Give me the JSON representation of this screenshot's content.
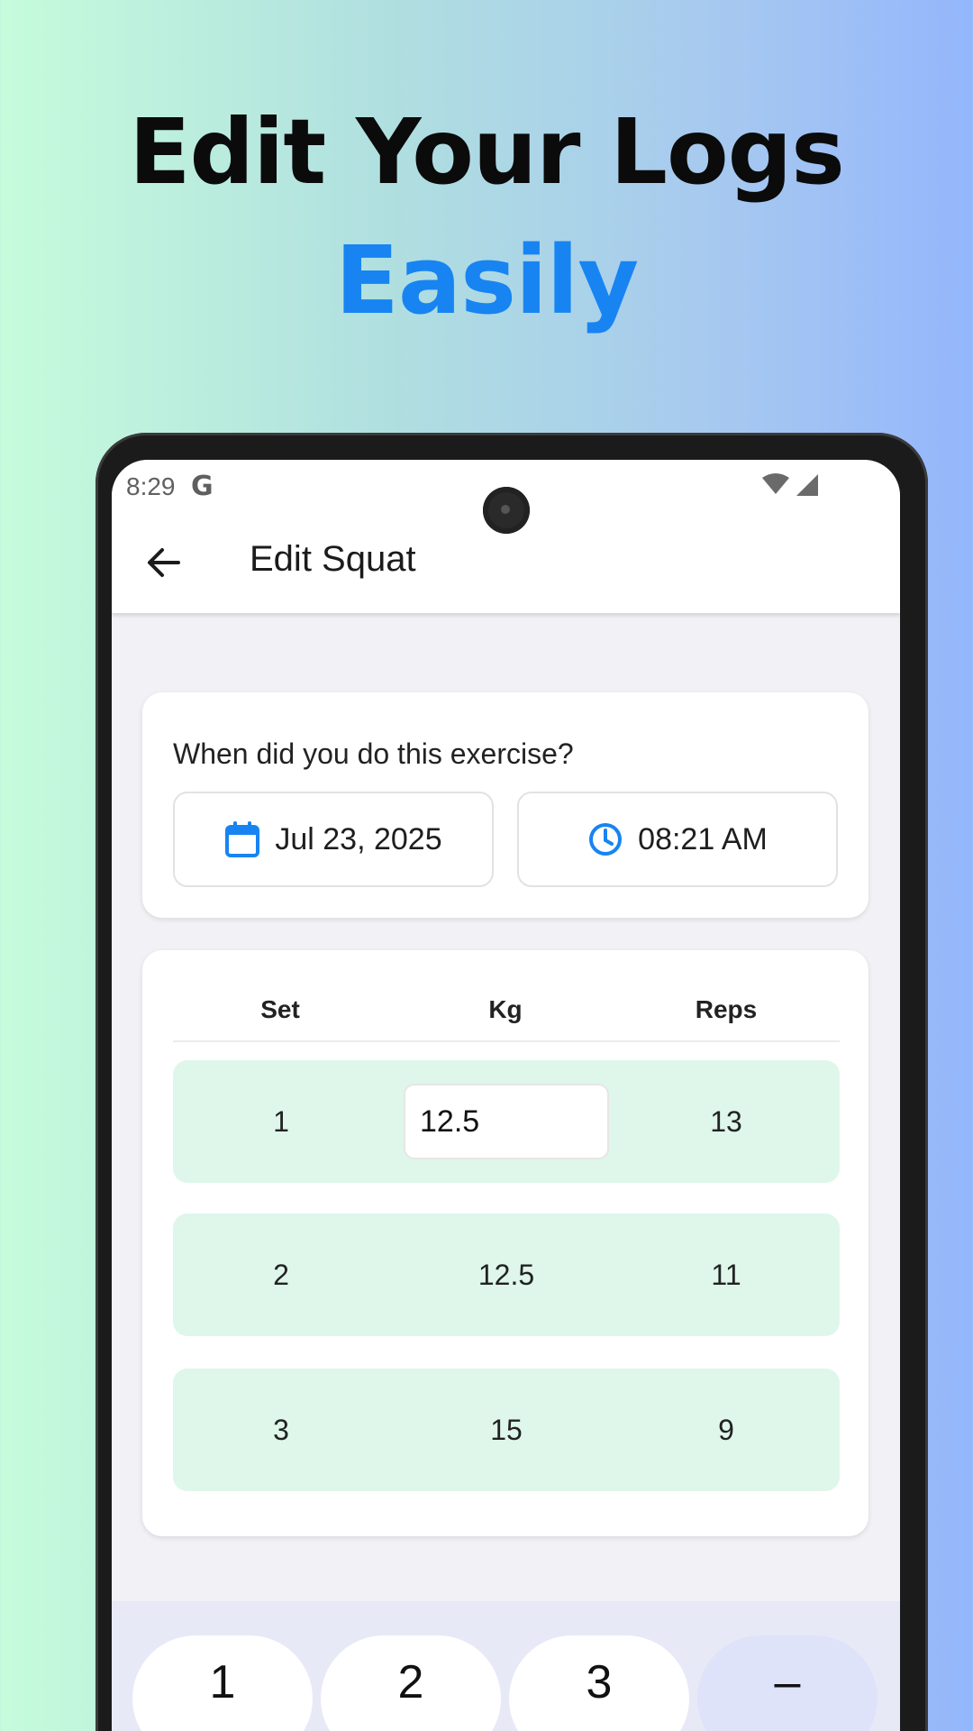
{
  "headline": {
    "line1": "Edit Your Logs",
    "line2": "Easily"
  },
  "status_bar": {
    "time": "8:29",
    "google_glyph": "G"
  },
  "app_bar": {
    "title": "Edit Squat",
    "back_icon": "arrow-left-icon"
  },
  "when_card": {
    "label": "When did you do this exercise?",
    "date": "Jul 23, 2025",
    "time": "08:21 AM",
    "date_icon": "calendar-icon",
    "time_icon": "clock-icon"
  },
  "sets_table": {
    "headers": [
      "Set",
      "Kg",
      "Reps"
    ],
    "rows": [
      {
        "set": "1",
        "kg": "12.5",
        "reps": "13"
      },
      {
        "set": "2",
        "kg": "12.5",
        "reps": "11"
      },
      {
        "set": "3",
        "kg": "15",
        "reps": "9"
      }
    ]
  },
  "keypad": {
    "keys": [
      "1",
      "2",
      "3",
      "–"
    ]
  },
  "colors": {
    "accent": "#1784f2",
    "row_bg": "#def7ea",
    "keypad_bg": "#e8e9f7",
    "minus_key_bg": "#dfe3f9"
  }
}
